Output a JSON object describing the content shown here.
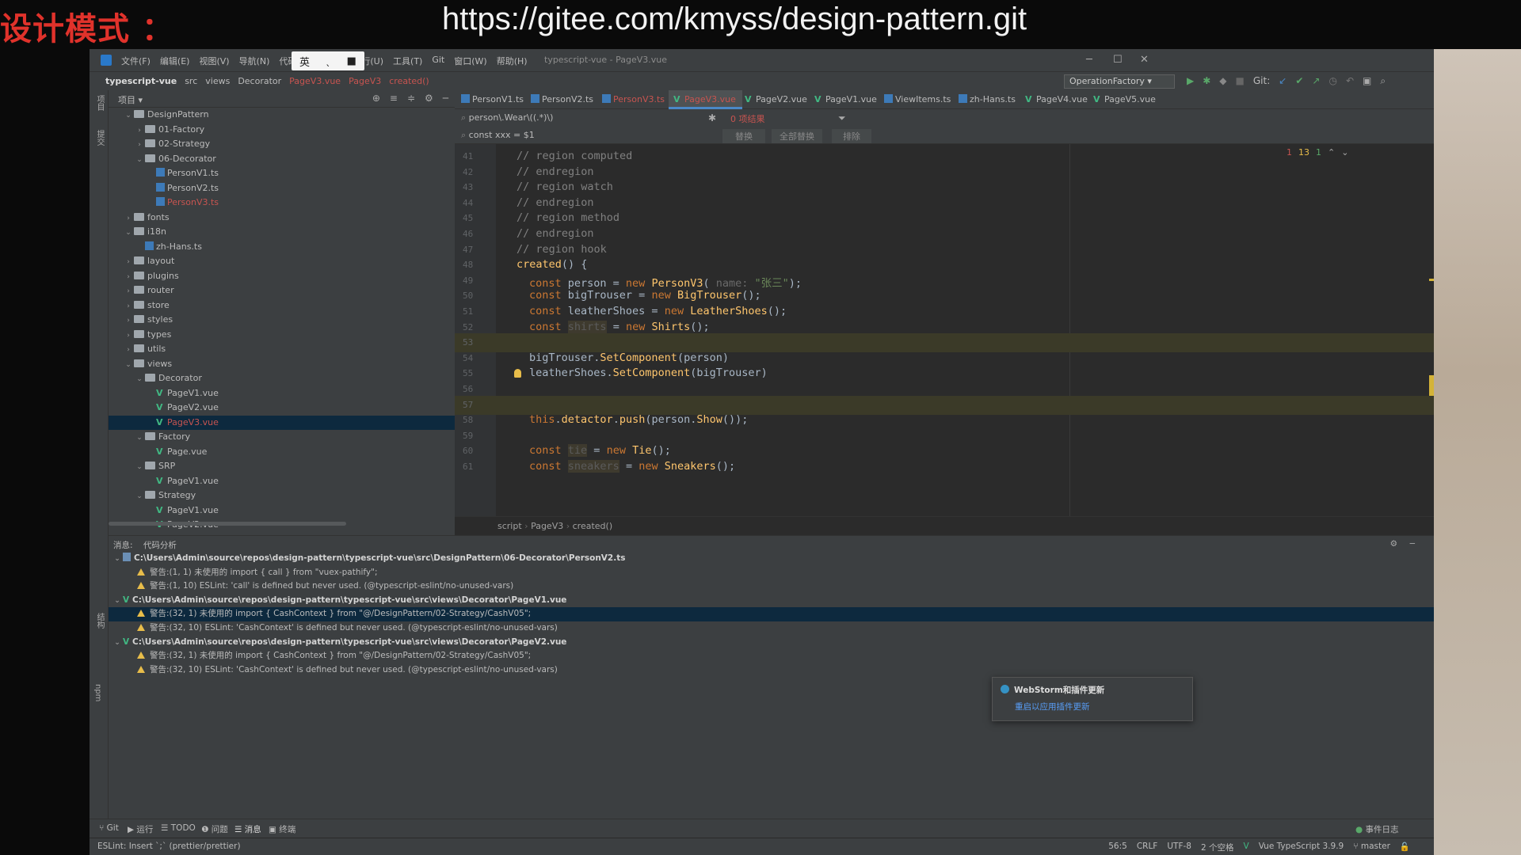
{
  "banner": {
    "left_text": "设计模式 ：",
    "url": "https://gitee.com/kmyss/design-pattern.git"
  },
  "titlebar": {
    "menu": [
      "文件(F)",
      "编辑(E)",
      "视图(V)",
      "导航(N)",
      "代码",
      "行(U)",
      "工具(T)",
      "Git",
      "窗口(W)",
      "帮助(H)"
    ],
    "ime": [
      "英",
      "ˎ",
      "■"
    ],
    "title": "typescript-vue - PageV3.vue"
  },
  "navbar": {
    "crumbs": [
      "typescript-vue",
      "src",
      "views",
      "Decorator",
      "PageV3.vue",
      "PageV3",
      "created()"
    ],
    "run_config": "OperationFactory",
    "git_label": "Git:"
  },
  "tool_stripe": [
    "项目",
    "提交",
    "结构",
    "npm"
  ],
  "project": {
    "title": "项目",
    "tree": [
      {
        "name": "DesignPattern",
        "type": "folder",
        "level": 1,
        "open": true
      },
      {
        "name": "01-Factory",
        "type": "folder",
        "level": 2,
        "open": false
      },
      {
        "name": "02-Strategy",
        "type": "folder",
        "level": 2,
        "open": false
      },
      {
        "name": "06-Decorator",
        "type": "folder",
        "level": 2,
        "open": true
      },
      {
        "name": "PersonV1.ts",
        "type": "ts",
        "level": 3
      },
      {
        "name": "PersonV2.ts",
        "type": "ts",
        "level": 3
      },
      {
        "name": "PersonV3.ts",
        "type": "ts",
        "level": 3,
        "error": true
      },
      {
        "name": "fonts",
        "type": "folder",
        "level": 1,
        "open": false
      },
      {
        "name": "i18n",
        "type": "folder",
        "level": 1,
        "open": true
      },
      {
        "name": "zh-Hans.ts",
        "type": "ts",
        "level": 2
      },
      {
        "name": "layout",
        "type": "folder",
        "level": 1,
        "open": false
      },
      {
        "name": "plugins",
        "type": "folder",
        "level": 1,
        "open": false
      },
      {
        "name": "router",
        "type": "folder",
        "level": 1,
        "open": false
      },
      {
        "name": "store",
        "type": "folder",
        "level": 1,
        "open": false
      },
      {
        "name": "styles",
        "type": "folder",
        "level": 1,
        "open": false
      },
      {
        "name": "types",
        "type": "folder",
        "level": 1,
        "open": false
      },
      {
        "name": "utils",
        "type": "folder",
        "level": 1,
        "open": false
      },
      {
        "name": "views",
        "type": "folder",
        "level": 1,
        "open": true
      },
      {
        "name": "Decorator",
        "type": "folder",
        "level": 2,
        "open": true
      },
      {
        "name": "PageV1.vue",
        "type": "vue",
        "level": 3
      },
      {
        "name": "PageV2.vue",
        "type": "vue",
        "level": 3
      },
      {
        "name": "PageV3.vue",
        "type": "vue",
        "level": 3,
        "error": true,
        "selected": true
      },
      {
        "name": "Factory",
        "type": "folder",
        "level": 2,
        "open": true
      },
      {
        "name": "Page.vue",
        "type": "vue",
        "level": 3
      },
      {
        "name": "SRP",
        "type": "folder",
        "level": 2,
        "open": true
      },
      {
        "name": "PageV1.vue",
        "type": "vue",
        "level": 3
      },
      {
        "name": "Strategy",
        "type": "folder",
        "level": 2,
        "open": true
      },
      {
        "name": "PageV1.vue",
        "type": "vue",
        "level": 3
      },
      {
        "name": "PageV2.vue",
        "type": "vue",
        "level": 3
      },
      {
        "name": "PageV3.vue",
        "type": "vue",
        "level": 3
      },
      {
        "name": "PageV4.vue",
        "type": "vue",
        "level": 3
      },
      {
        "name": "PageV5.vue",
        "type": "vue",
        "level": 3
      }
    ]
  },
  "editor": {
    "tabs": [
      {
        "label": "PersonV1.ts",
        "icon": "ts"
      },
      {
        "label": "PersonV2.ts",
        "icon": "ts"
      },
      {
        "label": "PersonV3.ts",
        "icon": "ts",
        "error": true
      },
      {
        "label": "PageV3.vue",
        "icon": "vue",
        "active": true
      },
      {
        "label": "PageV2.vue",
        "icon": "vue"
      },
      {
        "label": "PageV1.vue",
        "icon": "vue"
      },
      {
        "label": "ViewItems.ts",
        "icon": "ts"
      },
      {
        "label": "zh-Hans.ts",
        "icon": "ts"
      },
      {
        "label": "PageV4.vue",
        "icon": "vue"
      },
      {
        "label": "PageV5.vue",
        "icon": "vue"
      }
    ],
    "search_value": "person\\.Wear\\((.*)\\)",
    "replace_value": "const xxx = $1",
    "search_result": "0 项结果",
    "replace_buttons": [
      "替换",
      "全部替换",
      "排除"
    ],
    "inspections": {
      "errors": "1",
      "warnings": "13",
      "checks": "1"
    },
    "lines": [
      {
        "num": "41",
        "html": "<span class='cm'>// region computed</span>",
        "indent": 0
      },
      {
        "num": "42",
        "html": "<span class='cm'>// endregion</span>",
        "indent": 0
      },
      {
        "num": "43",
        "html": "<span class='cm'>// region watch</span>",
        "indent": 0
      },
      {
        "num": "44",
        "html": "<span class='cm'>// endregion</span>",
        "indent": 0
      },
      {
        "num": "45",
        "html": "<span class='cm'>// region method</span>",
        "indent": 0
      },
      {
        "num": "46",
        "html": "<span class='cm'>// endregion</span>",
        "indent": 0
      },
      {
        "num": "47",
        "html": "<span class='cm'>// region hook</span>",
        "indent": 0
      },
      {
        "num": "48",
        "html": "<span class='fn'>created</span>() {",
        "indent": 0
      },
      {
        "num": "49",
        "html": "<span class='kw'>const</span> person = <span class='kw'>new</span> <span class='fn'>PersonV3</span>( <span class='ph'>name:</span> <span class='str'>\"张三\"</span>);",
        "indent": 1
      },
      {
        "num": "50",
        "html": "<span class='kw'>const</span> bigTrouser = <span class='kw'>new</span> <span class='fn'>BigTrouser</span>();",
        "indent": 1
      },
      {
        "num": "51",
        "html": "<span class='kw'>const</span> leatherShoes = <span class='kw'>new</span> <span class='fn'>LeatherShoes</span>();",
        "indent": 1
      },
      {
        "num": "52",
        "html": "<span class='kw'>const</span> <span class='un'>shirts</span> = <span class='kw'>new</span> <span class='fn'>Shirts</span>();",
        "indent": 1
      },
      {
        "num": "53",
        "html": "",
        "indent": 1,
        "hl": true
      },
      {
        "num": "54",
        "html": "bigTrouser.<span class='mt'>SetComponent</span>(person)",
        "indent": 1
      },
      {
        "num": "55",
        "html": "leatherShoes.<span class='mt'>SetComponent</span>(bigTrouser)",
        "indent": 1,
        "bulb": true
      },
      {
        "num": "56",
        "html": "",
        "indent": 1
      },
      {
        "num": "57",
        "html": "",
        "indent": 1,
        "hl": true
      },
      {
        "num": "58",
        "html": "<span class='kw'>this</span>.<span class='mt'>detactor</span>.<span class='mt'>push</span>(person.<span class='mt'>Show</span>());",
        "indent": 1
      },
      {
        "num": "59",
        "html": "",
        "indent": 1
      },
      {
        "num": "60",
        "html": "<span class='kw'>const</span> <span class='un'>tie</span> = <span class='kw'>new</span> <span class='fn'>Tie</span>();",
        "indent": 1
      },
      {
        "num": "61",
        "html": "<span class='kw'>const</span> <span class='un'>sneakers</span> = <span class='kw'>new</span> <span class='fn'>Sneakers</span>();",
        "indent": 1
      }
    ],
    "breadcrumb": [
      "script",
      "PageV3",
      "created()"
    ]
  },
  "messages": {
    "tabs": [
      "消息:",
      "代码分析"
    ],
    "rows": [
      {
        "kind": "file",
        "icon": "ts",
        "text": "C:\\Users\\Admin\\source\\repos\\design-pattern\\typescript-vue\\src\\DesignPattern\\06-Decorator\\PersonV2.ts"
      },
      {
        "kind": "warn",
        "text": "警告:(1, 1)  未使用的 import { call } from \"vuex-pathify\";"
      },
      {
        "kind": "warn",
        "text": "警告:(1, 10)  ESLint: 'call' is defined but never used. (@typescript-eslint/no-unused-vars)"
      },
      {
        "kind": "file",
        "icon": "vue",
        "text": "C:\\Users\\Admin\\source\\repos\\design-pattern\\typescript-vue\\src\\views\\Decorator\\PageV1.vue"
      },
      {
        "kind": "warn",
        "sel": true,
        "text": "警告:(32, 1)  未使用的 import { CashContext } from \"@/DesignPattern/02-Strategy/CashV05\";"
      },
      {
        "kind": "warn",
        "text": "警告:(32, 10)  ESLint: 'CashContext' is defined but never used. (@typescript-eslint/no-unused-vars)"
      },
      {
        "kind": "file",
        "icon": "vue",
        "text": "C:\\Users\\Admin\\source\\repos\\design-pattern\\typescript-vue\\src\\views\\Decorator\\PageV2.vue"
      },
      {
        "kind": "warn",
        "text": "警告:(32, 1)  未使用的 import { CashContext } from \"@/DesignPattern/02-Strategy/CashV05\";"
      },
      {
        "kind": "warn",
        "text": "警告:(32, 10)  ESLint: 'CashContext' is defined but never used. (@typescript-eslint/no-unused-vars)"
      }
    ],
    "notification": {
      "title": "WebStorm和插件更新",
      "link": "重启以应用插件更新"
    }
  },
  "toolwindows": [
    "Git",
    "运行",
    "TODO",
    "问题",
    "消息",
    "终端",
    "事件日志"
  ],
  "status": {
    "left": "ESLint: Insert `;` (prettier/prettier)",
    "position": "56:5",
    "line_sep": "CRLF",
    "encoding": "UTF-8",
    "indent": "2 个空格",
    "lang": "Vue TypeScript 3.9.9",
    "branch": "master"
  },
  "colors": {
    "accent": "#4a88c7",
    "error": "#c75450",
    "warning": "#e8bd4a",
    "vue": "#41b883"
  }
}
